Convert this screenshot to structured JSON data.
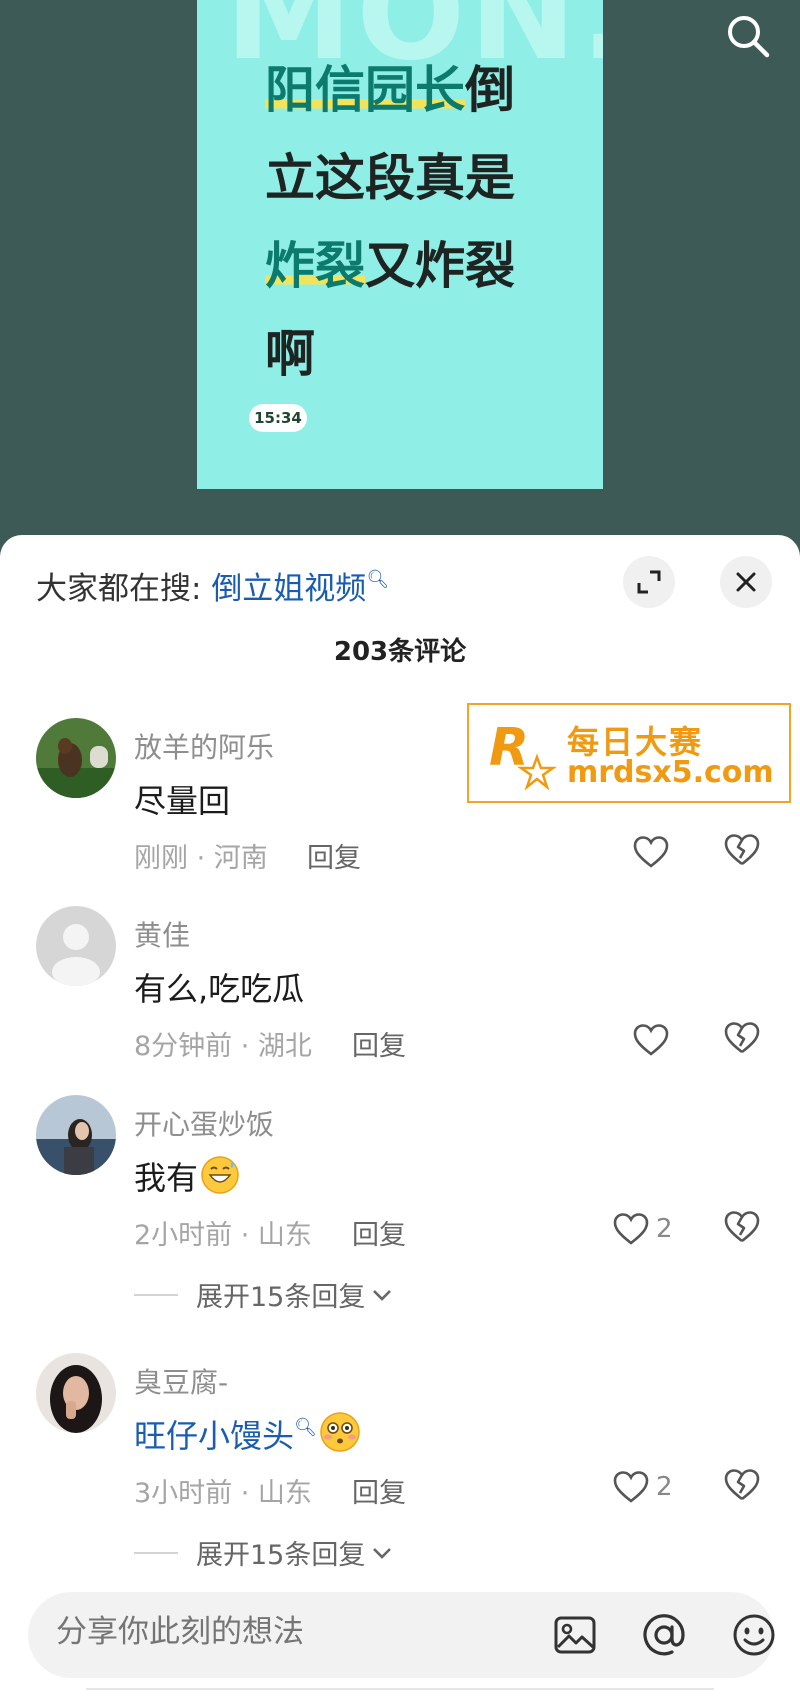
{
  "video": {
    "bg_word": "MON.",
    "line1_hl": "阳信园长",
    "line1_rest": "倒",
    "line2": "立这段真是",
    "line3_hl": "炸裂",
    "line3_rest": "又炸裂",
    "line4": "啊",
    "timestamp": "15:34",
    "search_icon": "search-icon"
  },
  "sheet": {
    "trend_prefix": "大家都在搜:",
    "trend_query": "倒立姐视频",
    "expand_icon": "expand-icon",
    "close_icon": "close-icon",
    "comment_count_title": "203条评论"
  },
  "comments": [
    {
      "name": "放羊的阿乐",
      "text": "尽量回",
      "meta": "刚刚 · 河南",
      "reply": "回复",
      "likes": ""
    },
    {
      "name": "黄佳",
      "text": "有么,吃吃瓜",
      "meta": "8分钟前 · 湖北",
      "reply": "回复",
      "likes": ""
    },
    {
      "name": "开心蛋炒饭",
      "text": "我有",
      "meta": "2小时前 · 山东",
      "reply": "回复",
      "likes": "2",
      "expand": "展开15条回复"
    },
    {
      "name": "臭豆腐-",
      "text": "旺仔小馒头",
      "meta": "3小时前 · 山东",
      "reply": "回复",
      "likes": "2",
      "expand": "展开15条回复"
    }
  ],
  "watermark": {
    "line1": "每日大赛",
    "line2": "mrdsx5.com",
    "logo_letter": "R",
    "logo_small": "每日大赛"
  },
  "input": {
    "placeholder": "分享你此刻的想法",
    "icons": [
      "image-icon",
      "at-icon",
      "emoji-icon"
    ]
  },
  "colors": {
    "accent_link": "#1a5db0",
    "video_bg": "#3e5a57",
    "card_bg": "#8fefe7",
    "watermark": "#f09a12"
  }
}
